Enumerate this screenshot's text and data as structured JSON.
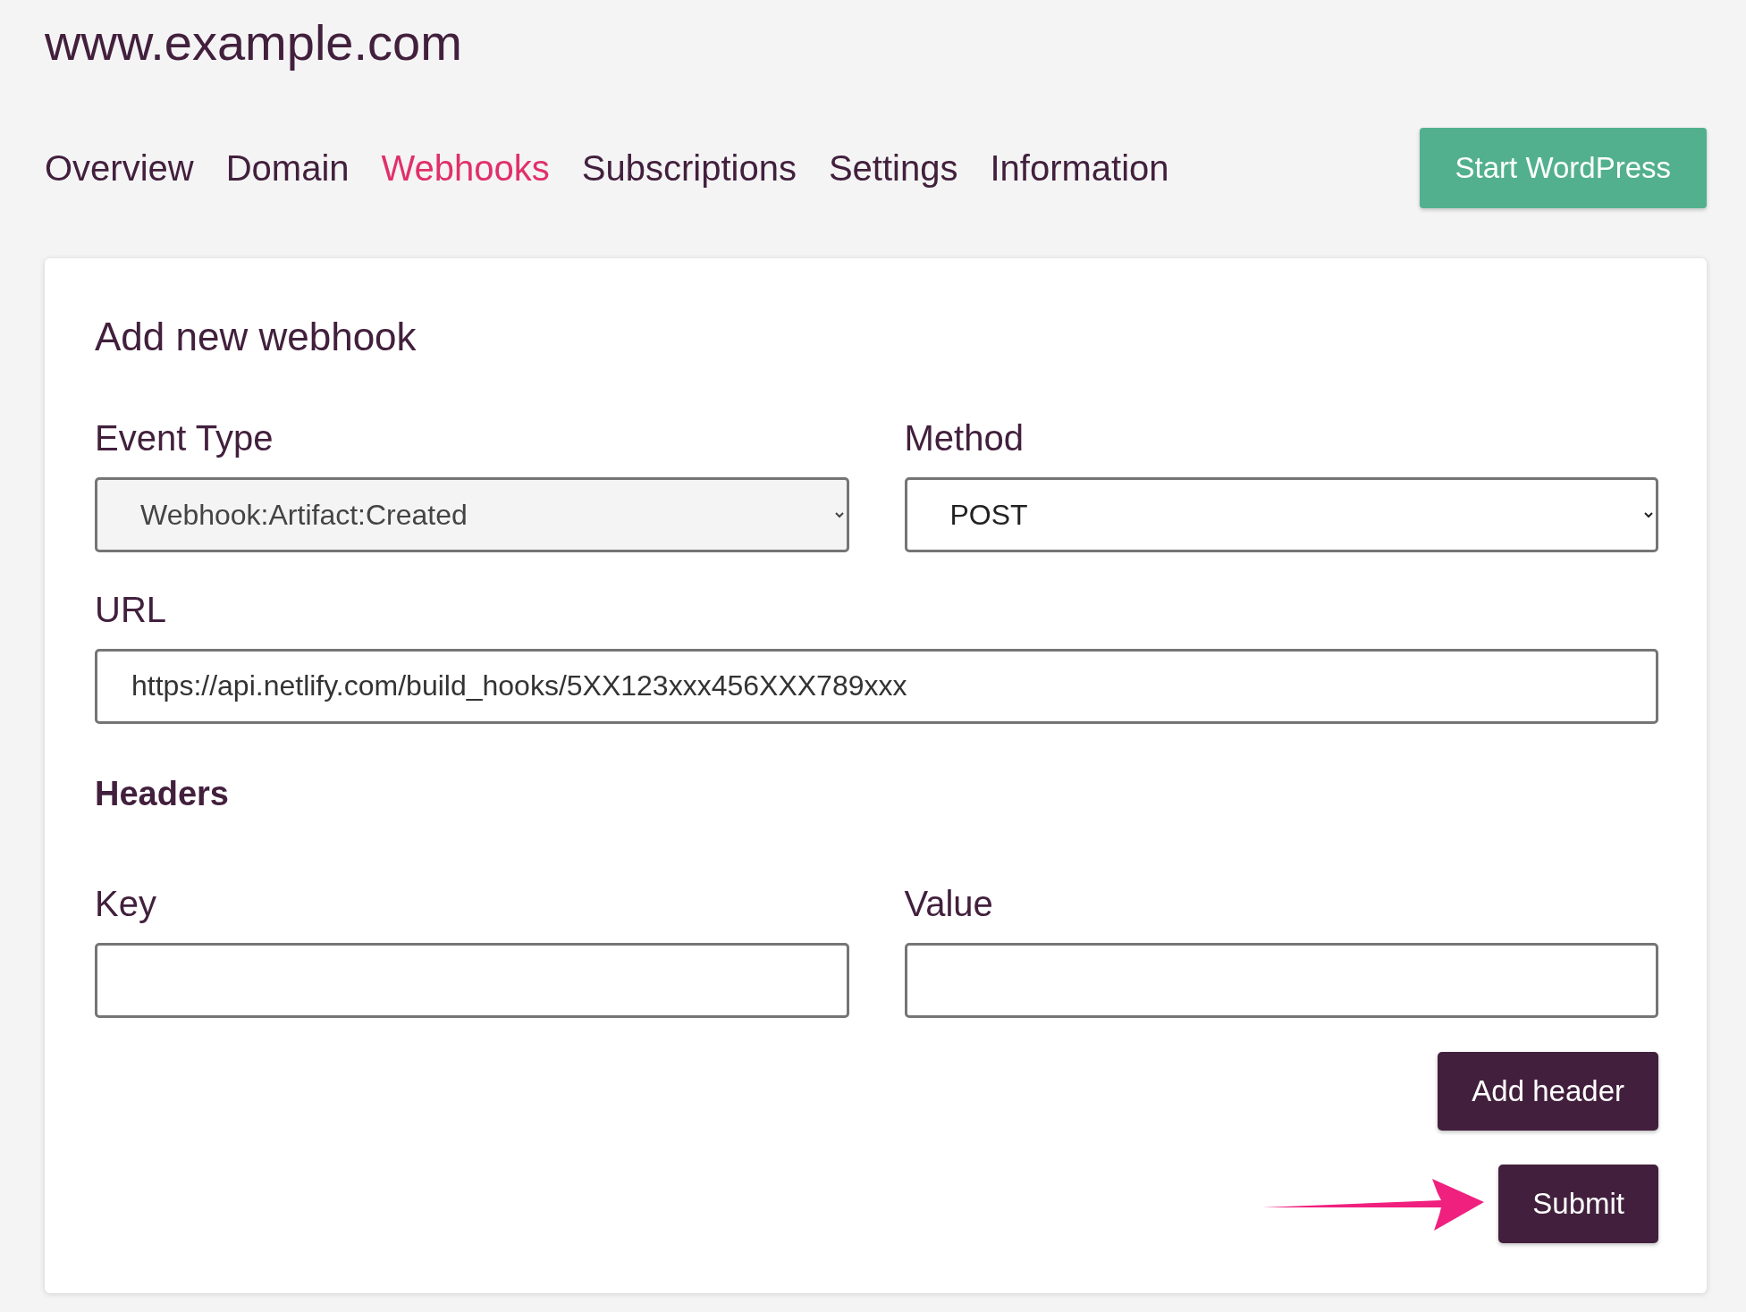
{
  "site_title": "www.example.com",
  "tabs": [
    {
      "label": "Overview",
      "selected": false
    },
    {
      "label": "Domain",
      "selected": false
    },
    {
      "label": "Webhooks",
      "selected": true
    },
    {
      "label": "Subscriptions",
      "selected": false
    },
    {
      "label": "Settings",
      "selected": false
    },
    {
      "label": "Information",
      "selected": false
    }
  ],
  "header_button": "Start WordPress",
  "form": {
    "title": "Add new webhook",
    "event_type": {
      "label": "Event Type",
      "value": "Webhook:Artifact:Created",
      "disabled": true
    },
    "method": {
      "label": "Method",
      "value": "POST",
      "disabled": false
    },
    "url": {
      "label": "URL",
      "value": "https://api.netlify.com/build_hooks/5XX123xxx456XXX789xxx"
    },
    "headers_title": "Headers",
    "key": {
      "label": "Key"
    },
    "value": {
      "label": "Value"
    },
    "add_header_button": "Add header",
    "submit_button": "Submit"
  }
}
